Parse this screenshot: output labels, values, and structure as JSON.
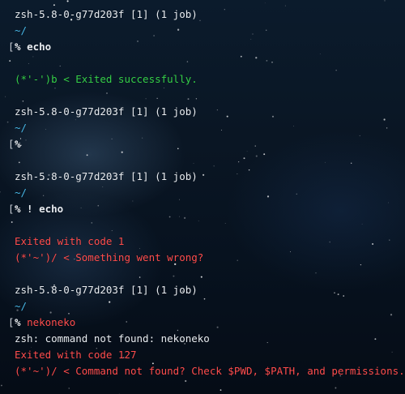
{
  "colors": {
    "text": "#e9edf2",
    "directory": "#48b8e8",
    "success": "#35d04a",
    "error": "#ff4d4d"
  },
  "blocks": [
    {
      "status": "zsh-5.8-0-g77d203f [1] (1 job)",
      "cwd": "~/",
      "prompt": "%",
      "command": "echo",
      "outputs": [
        {
          "text": "(*'-')b < Exited successfully.",
          "type": "success"
        }
      ]
    },
    {
      "status": "zsh-5.8-0-g77d203f [1] (1 job)",
      "cwd": "~/",
      "prompt": "%",
      "command": "",
      "outputs": []
    },
    {
      "status": "zsh-5.8-0-g77d203f [1] (1 job)",
      "cwd": "~/",
      "prompt": "% !",
      "command": "echo",
      "outputs": [
        {
          "text": "Exited with code 1",
          "type": "error"
        },
        {
          "text": "(*'~')/ < Something went wrong?",
          "type": "error"
        }
      ]
    },
    {
      "status": "zsh-5.8-0-g77d203f [1] (1 job)",
      "cwd": "~/",
      "prompt": "%",
      "command": "nekoneko",
      "command_type": "error",
      "outputs": [
        {
          "text": "zsh: command not found: nekoneko",
          "type": "text"
        },
        {
          "text": "Exited with code 127",
          "type": "error"
        },
        {
          "text": "(*'~')/ < Command not found? Check $PWD, $PATH, and permissions.",
          "type": "error"
        }
      ]
    }
  ]
}
